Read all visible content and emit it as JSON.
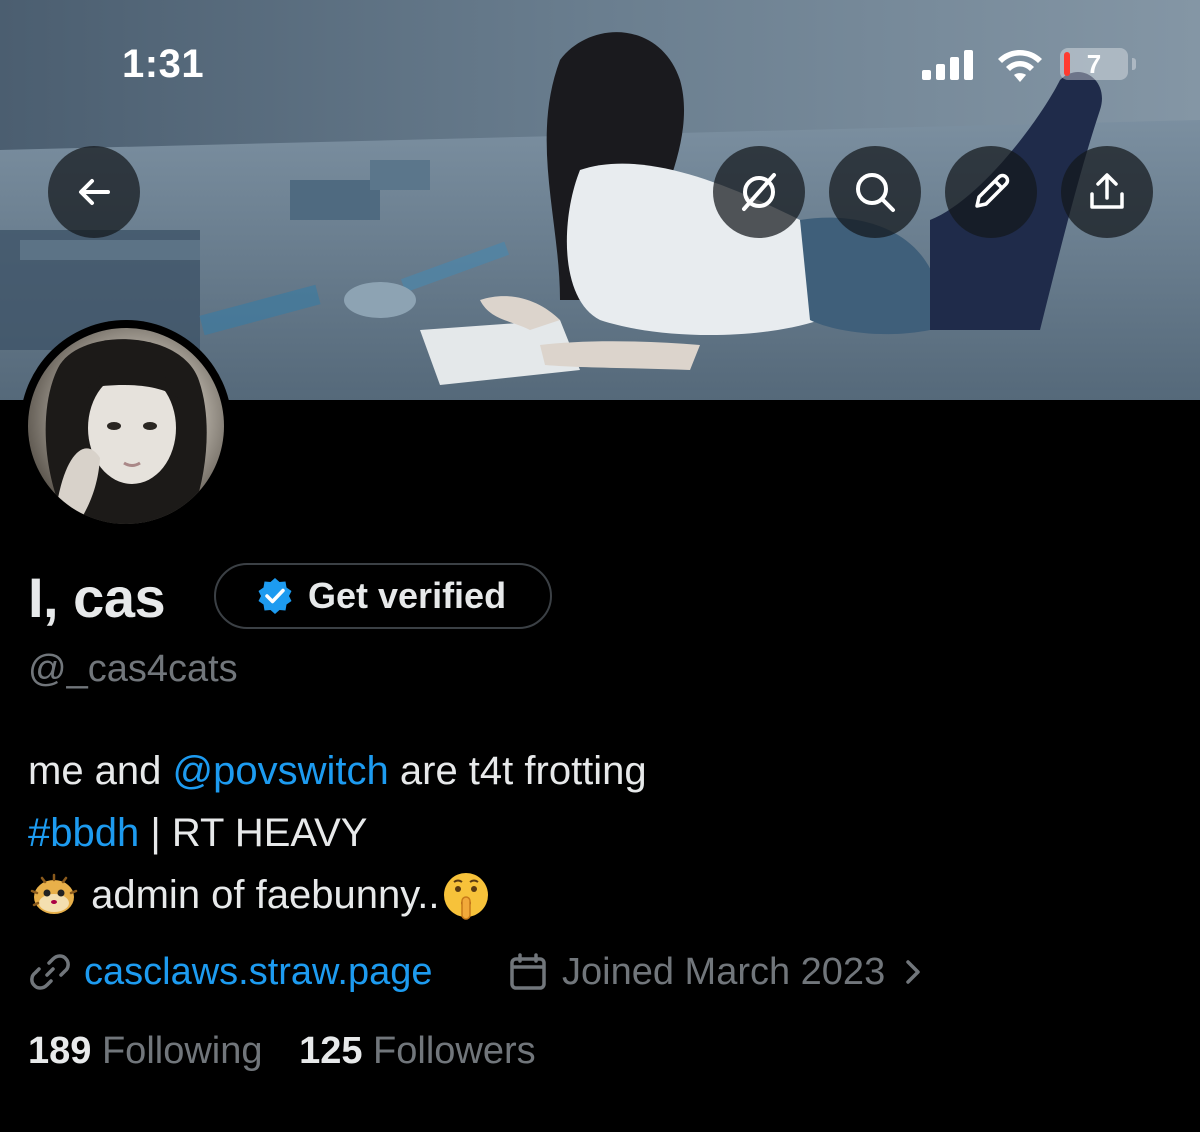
{
  "status_bar": {
    "time": "1:31",
    "battery_level": "7"
  },
  "header": {
    "back_icon": "arrow-left-icon",
    "actions": [
      {
        "name": "grok-icon"
      },
      {
        "name": "search-icon"
      },
      {
        "name": "edit-pencil-icon"
      },
      {
        "name": "share-icon"
      }
    ]
  },
  "profile": {
    "display_name": "I, cas",
    "verify_button_label": "Get verified",
    "handle": "@_cas4cats",
    "bio": {
      "line1_pre": "me and ",
      "line1_mention": "@povswitch",
      "line1_post": " are t4t frotting",
      "line2_hashtag": "#bbdh",
      "line2_post": " | RT HEAVY",
      "line3_text": " admin of faebunny..",
      "line3_emoji_start": "blowfish-emoji",
      "line3_emoji_end": "shushing-face-emoji"
    },
    "website": "casclaws.straw.page",
    "joined": "Joined March 2023",
    "following_count": "189",
    "following_label": "Following",
    "followers_count": "125",
    "followers_label": "Followers"
  },
  "colors": {
    "background": "#000000",
    "text_primary": "#e7e9ea",
    "text_secondary": "#71767b",
    "link": "#1d9bf0",
    "battery_low": "#ff3b30"
  }
}
